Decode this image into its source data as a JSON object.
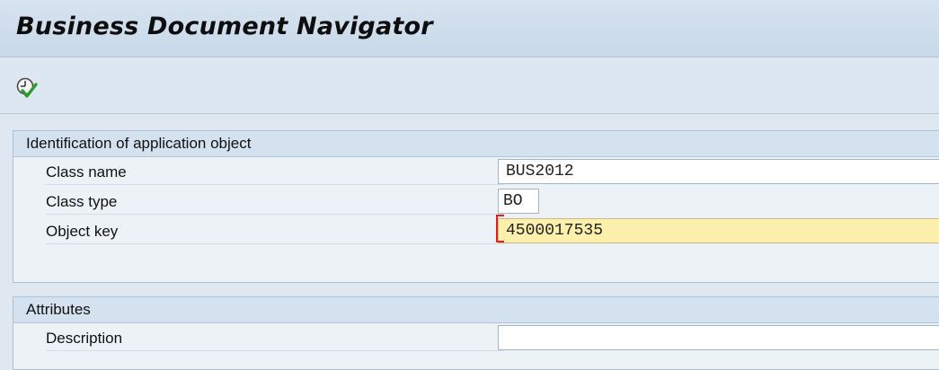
{
  "window": {
    "title": "Business Document Navigator"
  },
  "toolbar": {
    "execute_icon": "execute-clock-check-icon"
  },
  "identification": {
    "header": "Identification of application object",
    "class_name": {
      "label": "Class name",
      "value": "BUS2012"
    },
    "class_type": {
      "label": "Class type",
      "value": "BO"
    },
    "object_key": {
      "label": "Object key",
      "value": "4500017535"
    }
  },
  "attributes": {
    "header": "Attributes",
    "description": {
      "label": "Description",
      "value": ""
    }
  },
  "colors": {
    "focus_field": "#fdf0ad",
    "cursor_marker": "#e02020"
  }
}
